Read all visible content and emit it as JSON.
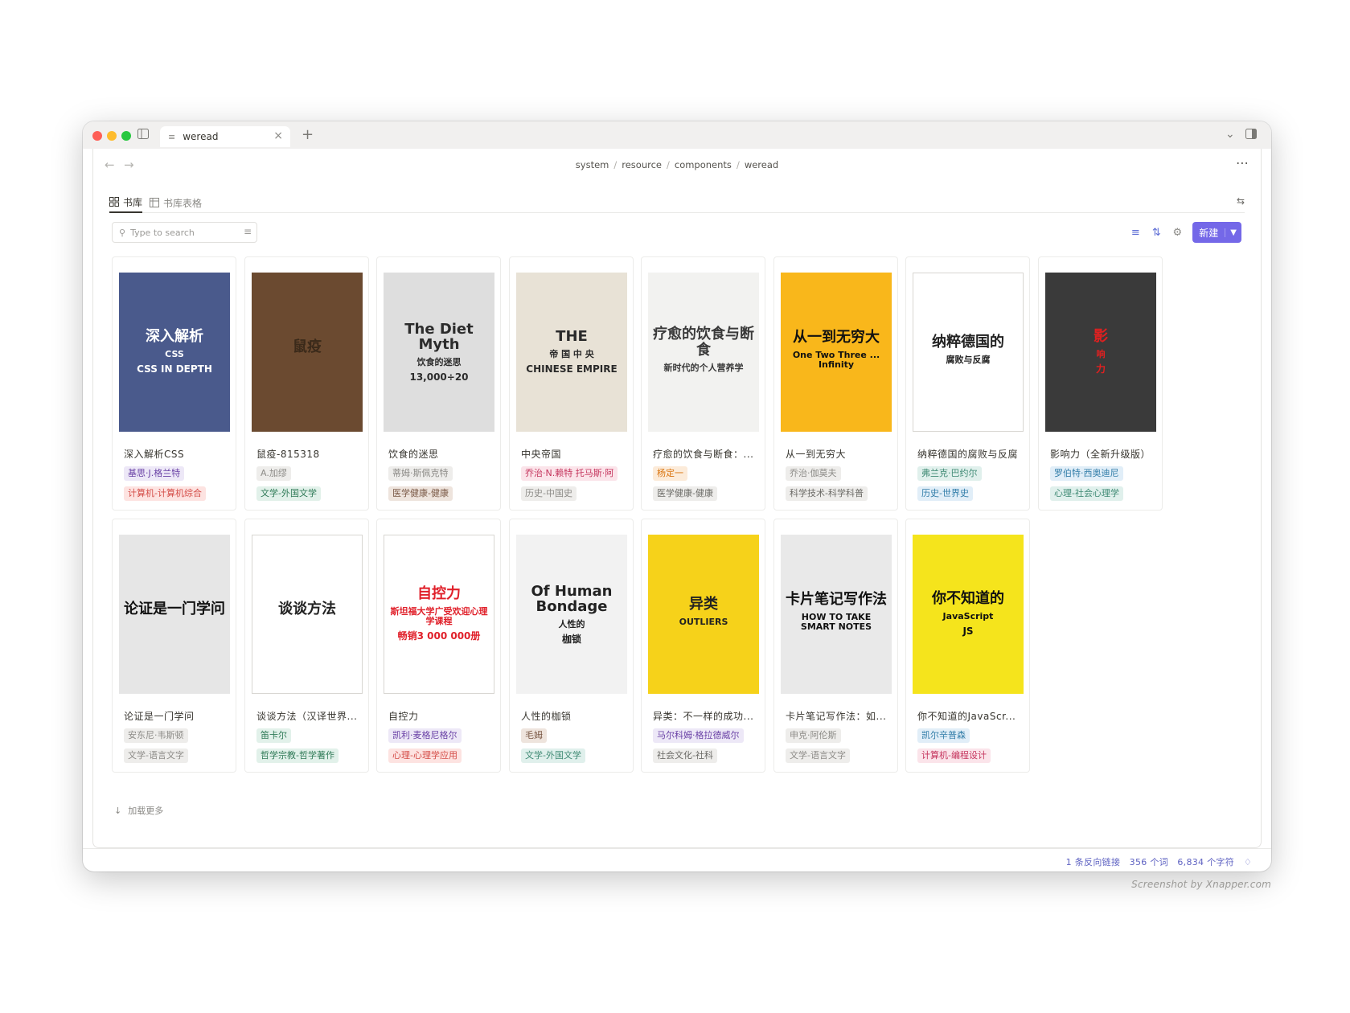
{
  "window": {
    "tab_title": "weread",
    "breadcrumb": [
      "system",
      "resource",
      "components",
      "weread"
    ]
  },
  "views": {
    "active": "书库",
    "inactive": "书库表格"
  },
  "search": {
    "placeholder": "Type to search"
  },
  "toolbar": {
    "new_label": "新建"
  },
  "books": [
    {
      "title": "深入解析CSS",
      "author": "基思·J.格兰特",
      "category": "计算机-计算机综合",
      "author_color": "purple",
      "category_color": "red",
      "cover": {
        "bg": "#4a5a8c",
        "fg": "#ffffff",
        "line1": "深入解析",
        "line2": "CSS",
        "line3": "CSS IN DEPTH"
      }
    },
    {
      "title": "鼠疫-815318",
      "author": "A.加缪",
      "category": "文学-外国文学",
      "author_color": "gray",
      "category_color": "green",
      "cover": {
        "bg": "#6b4a30",
        "fg": "#3b2a1a",
        "line1": "鼠疫",
        "line2": "",
        "line3": ""
      }
    },
    {
      "title": "饮食的迷思",
      "author": "蒂姆·斯佩克特",
      "category": "医学健康-健康",
      "author_color": "gray",
      "category_color": "brown",
      "cover": {
        "bg": "#dedede",
        "fg": "#2c2c2c",
        "line1": "The Diet Myth",
        "line2": "饮食的迷思",
        "line3": "13,000÷20"
      }
    },
    {
      "title": "中央帝国",
      "author": "乔治·N.赖特 托马斯·阿",
      "category": "历史-中国史",
      "author_color": "pink",
      "category_color": "gray",
      "cover": {
        "bg": "#e8e2d6",
        "fg": "#2a2a2a",
        "line1": "THE",
        "line2": "帝 国 中 央",
        "line3": "CHINESE EMPIRE"
      }
    },
    {
      "title": "疗愈的饮食与断食：...",
      "author": "杨定一",
      "category": "医学健康-健康",
      "author_color": "orange",
      "category_color": "gray2",
      "cover": {
        "bg": "#f2f2f0",
        "fg": "#3a3a3a",
        "line1": "疗愈的饮食与断食",
        "line2": "新时代的个人营养学",
        "line3": ""
      }
    },
    {
      "title": "从一到无穷大",
      "author": "乔治·伽莫夫",
      "category": "科学技术-科学科普",
      "author_color": "gray",
      "category_color": "gray2",
      "cover": {
        "bg": "#f9b71b",
        "fg": "#111111",
        "line1": "从一到无穷大",
        "line2": "One Two Three ... Infinity",
        "line3": ""
      }
    },
    {
      "title": "纳粹德国的腐败与反腐",
      "author": "弗兰克·巴约尔",
      "category": "历史-世界史",
      "author_color": "teal",
      "category_color": "blue",
      "cover": {
        "bg": "#ffffff",
        "fg": "#222222",
        "line1": "纳粹德国的",
        "line2": "腐败与反腐",
        "line3": ""
      }
    },
    {
      "title": "影响力（全新升级版）",
      "author": "罗伯特·西奥迪尼",
      "category": "心理-社会心理学",
      "author_color": "blue",
      "category_color": "teal",
      "cover": {
        "bg": "#3a3a3a",
        "fg": "#e02020",
        "line1": "影",
        "line2": "响",
        "line3": "力"
      }
    },
    {
      "title": "论证是一门学问",
      "author": "安东尼·韦斯顿",
      "category": "文学-语言文字",
      "author_color": "gray",
      "category_color": "gray",
      "cover": {
        "bg": "#e6e6e6",
        "fg": "#111111",
        "line1": "论证是一门学问",
        "line2": "",
        "line3": ""
      }
    },
    {
      "title": "谈谈方法（汉译世界...",
      "author": "笛卡尔",
      "category": "哲学宗教-哲学著作",
      "author_color": "green",
      "category_color": "green",
      "cover": {
        "bg": "#ffffff",
        "fg": "#222222",
        "line1": "谈谈方法",
        "line2": "",
        "line3": ""
      }
    },
    {
      "title": "自控力",
      "author": "凯利·麦格尼格尔",
      "category": "心理-心理学应用",
      "author_color": "purple",
      "category_color": "red",
      "cover": {
        "bg": "#ffffff",
        "fg": "#e0202a",
        "line1": "自控力",
        "line2": "斯坦福大学广受欢迎心理学课程",
        "line3": "畅销3 000 000册"
      }
    },
    {
      "title": "人性的枷锁",
      "author": "毛姆",
      "category": "文学-外国文学",
      "author_color": "brown",
      "category_color": "teal",
      "cover": {
        "bg": "#f2f2f2",
        "fg": "#222222",
        "line1": "Of Human Bondage",
        "line2": "人性的",
        "line3": "枷锁"
      }
    },
    {
      "title": "异类：不一样的成功...",
      "author": "马尔科姆·格拉德威尔",
      "category": "社会文化-社科",
      "author_color": "purple",
      "category_color": "gray2",
      "cover": {
        "bg": "#f6d21a",
        "fg": "#222222",
        "line1": "异类",
        "line2": "OUTLIERS",
        "line3": ""
      }
    },
    {
      "title": "卡片笔记写作法：如...",
      "author": "申克·阿伦斯",
      "category": "文学-语言文字",
      "author_color": "gray",
      "category_color": "gray",
      "cover": {
        "bg": "#e9e9e9",
        "fg": "#111111",
        "line1": "卡片笔记写作法",
        "line2": "HOW TO TAKE SMART NOTES",
        "line3": ""
      }
    },
    {
      "title": "你不知道的JavaScr...",
      "author": "凯尔辛普森",
      "category": "计算机-编程设计",
      "author_color": "blue",
      "category_color": "pink",
      "cover": {
        "bg": "#f5e41c",
        "fg": "#111111",
        "line1": "你不知道的",
        "line2": "JavaScript",
        "line3": "JS"
      }
    }
  ],
  "load_more": "加载更多",
  "status": {
    "backlinks": "1 条反向链接",
    "words": "356 个词",
    "chars": "6,834 个字符"
  },
  "watermark": "Screenshot by Xnapper.com",
  "colors": {
    "accent": "#7468e8",
    "link": "#5e62c2"
  }
}
